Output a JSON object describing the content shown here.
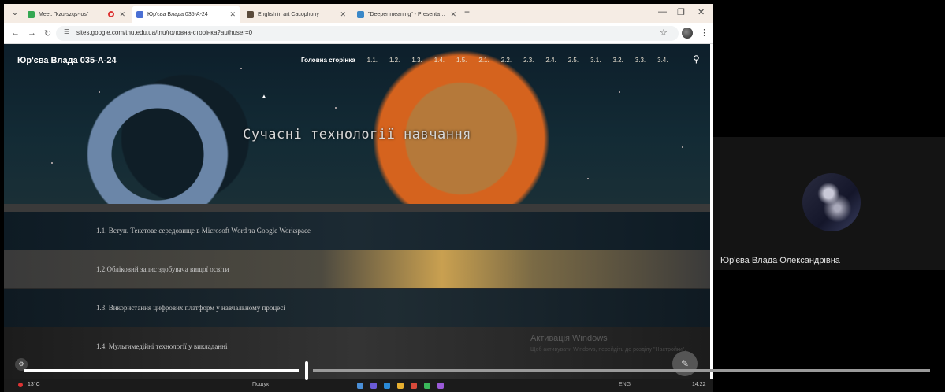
{
  "browser": {
    "tabs": [
      {
        "label": "Meet: \"kzu-szqs-jos\"",
        "favicon_color": "#34a853",
        "recording": true
      },
      {
        "label": "Юр'єва Влада 035-А-24",
        "favicon_color": "#4a6fd4",
        "active": true
      },
      {
        "label": "English in art Cacophony",
        "favicon_color": "#5a4a3a"
      },
      {
        "label": "\"Deeper meaning\" - Presentati...",
        "favicon_color": "#3a88c8"
      }
    ],
    "url": "sites.google.com/tnu.edu.ua/tnu/головна-сторінка?authuser=0"
  },
  "site": {
    "title": "Юр'єва Влада 035-А-24",
    "nav": [
      "Головна сторінка",
      "1.1.",
      "1.2.",
      "1.3.",
      "1.4.",
      "1.5.",
      "2.1.",
      "2.2.",
      "2.3.",
      "2.4.",
      "2.5.",
      "3.1.",
      "3.2.",
      "3.3.",
      "3.4."
    ],
    "hero_title": "Сучасні технології навчання",
    "sections": [
      "1.1. Вступ. Текстове середовище в Microsoft Word та Google Workspace",
      "1.2.Обліковий запис здобувача вищої освіти",
      "1.3. Використання цифрових платформ у навчальному процесі",
      "1.4. Мультимедійні технології у викладанні"
    ],
    "watermark": "Активація Windows",
    "watermark_sub": "Щоб активувати Windows, перейдіть до розділу \"Настройки\"."
  },
  "taskbar": {
    "weather": "13°C",
    "search": "Пошук",
    "lang": "ENG",
    "time": "14:22"
  },
  "video": {
    "progress": 0.31
  },
  "participant": {
    "name": "Юр'єва Влада Олександрівна"
  },
  "colors": {
    "hero_sun": "#d5631e",
    "row_gold": "#c9a050",
    "seek_played": "#ffffff"
  }
}
